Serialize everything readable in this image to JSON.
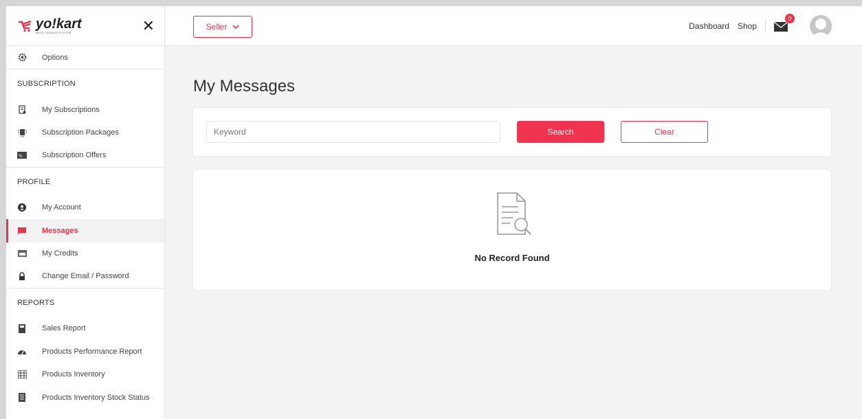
{
  "brand": {
    "name": "yo!kart",
    "tagline": "MULTI-VENDOR SYSTEM",
    "accent": "#e8344f"
  },
  "sidebar": {
    "options_label": "Options",
    "sections": [
      {
        "title": "SUBSCRIPTION",
        "items": [
          {
            "label": "My Subscriptions",
            "icon": "subscription-icon"
          },
          {
            "label": "Subscription Packages",
            "icon": "packages-icon"
          },
          {
            "label": "Subscription Offers",
            "icon": "offers-icon"
          }
        ]
      },
      {
        "title": "PROFILE",
        "items": [
          {
            "label": "My Account",
            "icon": "account-icon"
          },
          {
            "label": "Messages",
            "icon": "messages-icon",
            "active": true
          },
          {
            "label": "My Credits",
            "icon": "credits-icon"
          },
          {
            "label": "Change Email / Password",
            "icon": "lock-icon"
          }
        ]
      },
      {
        "title": "REPORTS",
        "items": [
          {
            "label": "Sales Report",
            "icon": "sales-report-icon"
          },
          {
            "label": "Products Performance Report",
            "icon": "performance-icon"
          },
          {
            "label": "Products Inventory",
            "icon": "inventory-icon"
          },
          {
            "label": "Products Inventory Stock Status",
            "icon": "stock-status-icon"
          }
        ]
      }
    ]
  },
  "header": {
    "role_select": "Seller",
    "nav": {
      "dashboard": "Dashboard",
      "shop": "Shop"
    },
    "message_count": "0"
  },
  "main": {
    "title": "My Messages",
    "search": {
      "placeholder": "Keyword",
      "search_label": "Search",
      "clear_label": "Clear"
    },
    "empty_text": "No Record Found"
  }
}
